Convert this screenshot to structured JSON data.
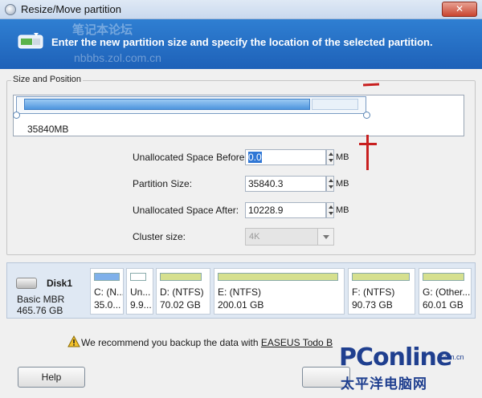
{
  "window": {
    "title": "Resize/Move partition",
    "close_glyph": "✕"
  },
  "banner": {
    "text": "Enter the new partition size and specify the location of the selected partition.",
    "watermark_cn": "笔记本论坛",
    "watermark_url": "nbbbs.zol.com.cn"
  },
  "size_position": {
    "legend": "Size and Position",
    "partition_size_label": "35840MB",
    "fill_fraction": 0.82
  },
  "fields": {
    "unalloc_before": {
      "label": "Unallocated Space Before:",
      "value": "0.0",
      "unit": "MB"
    },
    "partition_size": {
      "label": "Partition Size:",
      "value": "35840.3",
      "unit": "MB"
    },
    "unalloc_after": {
      "label": "Unallocated Space After:",
      "value": "10228.9",
      "unit": "MB"
    },
    "cluster_size": {
      "label": "Cluster size:",
      "value": "4K"
    }
  },
  "disk": {
    "name": "Disk1",
    "type": "Basic MBR",
    "size": "465.76 GB"
  },
  "partitions": [
    {
      "label": "C: (N...",
      "size": "35.0...",
      "bar_color": "#7fb0ea"
    },
    {
      "label": "Un...",
      "size": "9.9...",
      "bar_color": "#ffffff"
    },
    {
      "label": "D: (NTFS)",
      "size": "70.02 GB",
      "bar_color": "#d6e08e"
    },
    {
      "label": "E: (NTFS)",
      "size": "200.01 GB",
      "bar_color": "#d6e08e"
    },
    {
      "label": "F: (NTFS)",
      "size": "90.73 GB",
      "bar_color": "#d6e08e"
    },
    {
      "label": "G: (Other...",
      "size": "60.01 GB",
      "bar_color": "#d6e08e"
    }
  ],
  "warning": {
    "prefix": "We recommend you backup the data with ",
    "link": "EASEUS Todo B"
  },
  "buttons": {
    "help": "Help"
  },
  "logo": {
    "main": "PConline",
    "dotcom": ".com.cn",
    "cn": "太平洋电脑网"
  },
  "colors": {
    "banner": "#2272c8",
    "accent": "#3077d5",
    "annotation_red": "#c81f1f"
  }
}
